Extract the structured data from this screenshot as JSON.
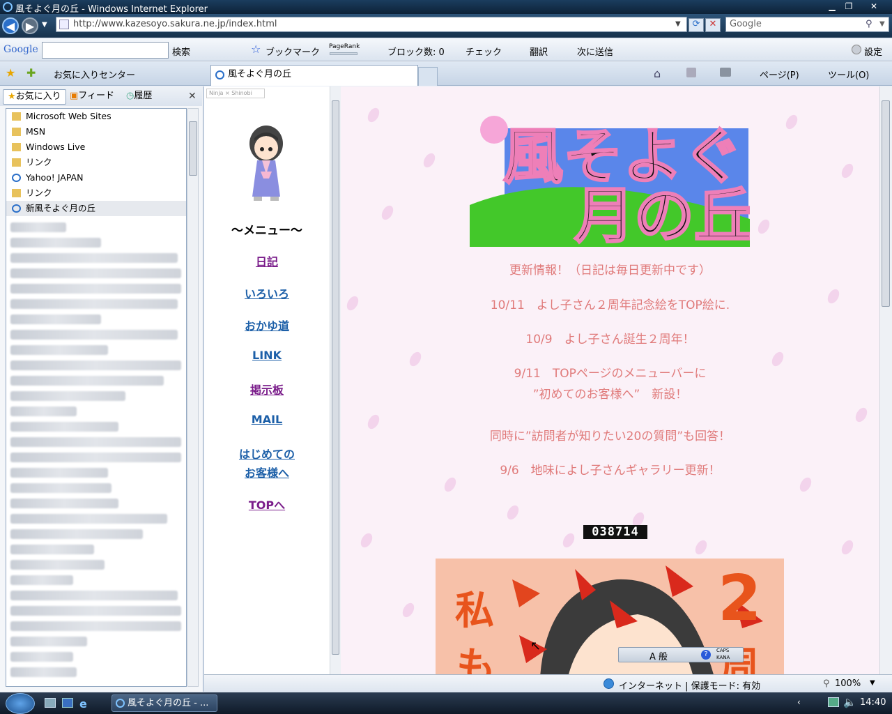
{
  "window": {
    "title": "風そよぐ月の丘 - Windows Internet Explorer"
  },
  "address": {
    "url": "http://www.kazesoyo.sakura.ne.jp/index.html",
    "search_placeholder": "Google"
  },
  "gtoolbar": {
    "logo": "Google",
    "search_label": "検索",
    "bookmark": "ブックマーク",
    "pagerank": "PageRank",
    "blocked": "ブロック数: 0",
    "check": "チェック",
    "translate": "翻訳",
    "send": "次に送信",
    "settings": "設定"
  },
  "favbar": {
    "favcenter": "お気に入りセンター",
    "tab_title": "風そよぐ月の丘",
    "page": "ページ(P)",
    "tools": "ツール(O)"
  },
  "sidebar": {
    "tabs": [
      "お気に入り",
      "フィード",
      "履歴"
    ],
    "items": [
      "Microsoft Web Sites",
      "MSN",
      "Windows Live",
      "リンク",
      "Yahoo! JAPAN",
      "リンク",
      "新風そよぐ月の丘"
    ]
  },
  "menu": {
    "badge": "Ninja × Shinobi",
    "heading": "～メニュー～",
    "items": [
      "日記",
      "いろいろ",
      "おかゆ道",
      "LINK",
      "掲示板",
      "MAIL",
      "はじめての",
      "お客様へ",
      "TOPへ"
    ]
  },
  "content": {
    "logo_lines": [
      "風そよぐ",
      "月の丘"
    ],
    "news": [
      "更新情報！（日記は毎日更新中です）",
      "10/11　よし子さん２周年記念絵をTOP絵に.",
      "10/9　よし子さん誕生２周年！",
      "9/11　TOPページのメニューバーに",
      "”初めてのお客様へ”　新設！",
      "同時に”訪問者が知りたい20の質問”も回答！",
      "9/6　地味によし子さんギャラリー更新！"
    ],
    "counter": "038714",
    "banner_text": [
      "私",
      "も",
      "2",
      "周"
    ]
  },
  "ime": {
    "mode": "A 般",
    "caps": "CAPS",
    "kana": "KANA"
  },
  "status": {
    "zone": "インターネット | 保護モード: 有効",
    "zoom": "100%"
  },
  "taskbar": {
    "task": "風そよぐ月の丘 - ...",
    "clock": "14:40"
  }
}
